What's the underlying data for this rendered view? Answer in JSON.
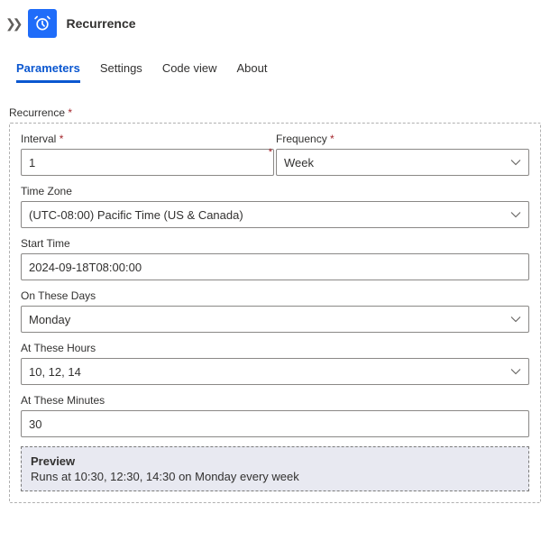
{
  "header": {
    "title": "Recurrence",
    "icon": "clock-alarm-icon"
  },
  "tabs": {
    "items": [
      {
        "label": "Parameters",
        "active": true
      },
      {
        "label": "Settings",
        "active": false
      },
      {
        "label": "Code view",
        "active": false
      },
      {
        "label": "About",
        "active": false
      }
    ]
  },
  "section": {
    "title": "Recurrence"
  },
  "fields": {
    "interval": {
      "label": "Interval",
      "value": "1",
      "required": true
    },
    "frequency": {
      "label": "Frequency",
      "value": "Week",
      "required": true
    },
    "timezone": {
      "label": "Time Zone",
      "value": "(UTC-08:00) Pacific Time (US & Canada)"
    },
    "start_time": {
      "label": "Start Time",
      "value": "2024-09-18T08:00:00"
    },
    "days": {
      "label": "On These Days",
      "value": "Monday"
    },
    "hours": {
      "label": "At These Hours",
      "value": "10, 12, 14"
    },
    "minutes": {
      "label": "At These Minutes",
      "value": "30"
    }
  },
  "preview": {
    "title": "Preview",
    "text": "Runs at 10:30, 12:30, 14:30 on Monday every week"
  }
}
